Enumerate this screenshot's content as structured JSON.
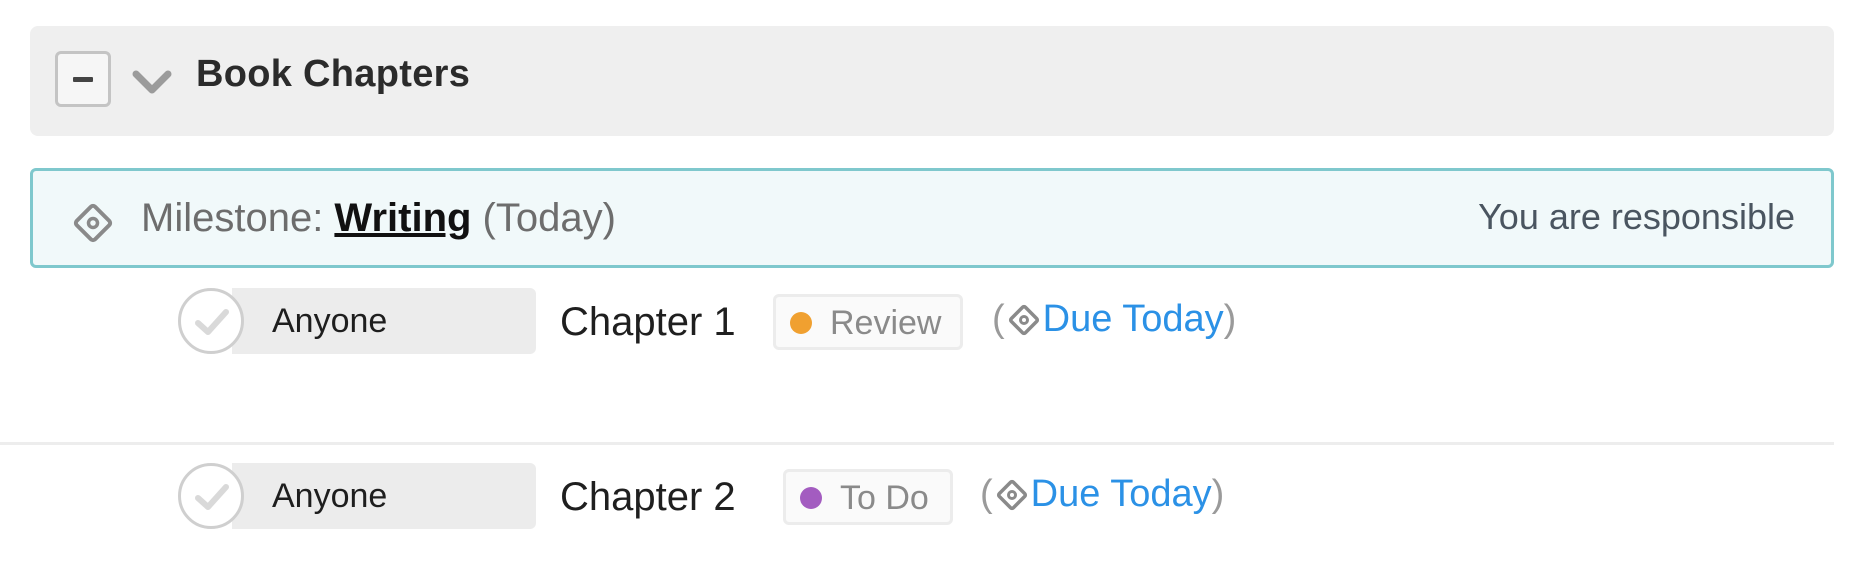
{
  "group": {
    "title": "Book Chapters"
  },
  "milestone": {
    "prefix": "Milestone: ",
    "name": "Writing",
    "suffix": " (Today)",
    "responsible": "You are responsible"
  },
  "tasks": [
    {
      "assignee": "Anyone",
      "name": "Chapter 1",
      "status": "Review",
      "status_color": "#f0a030",
      "open_paren": "(",
      "due": "Due Today",
      "close_paren": ")"
    },
    {
      "assignee": "Anyone",
      "name": "Chapter 2",
      "status": "To Do",
      "status_color": "#a35cc0",
      "open_paren": "(",
      "due": "Due Today",
      "close_paren": ")"
    }
  ],
  "colors": {
    "accent": "#7fc8cd",
    "link": "#2b91e6"
  },
  "icons": {
    "collapse": "minus-icon",
    "chevron": "chevron-down-icon",
    "milestone": "milestone-diamond-icon",
    "check": "check-icon"
  }
}
